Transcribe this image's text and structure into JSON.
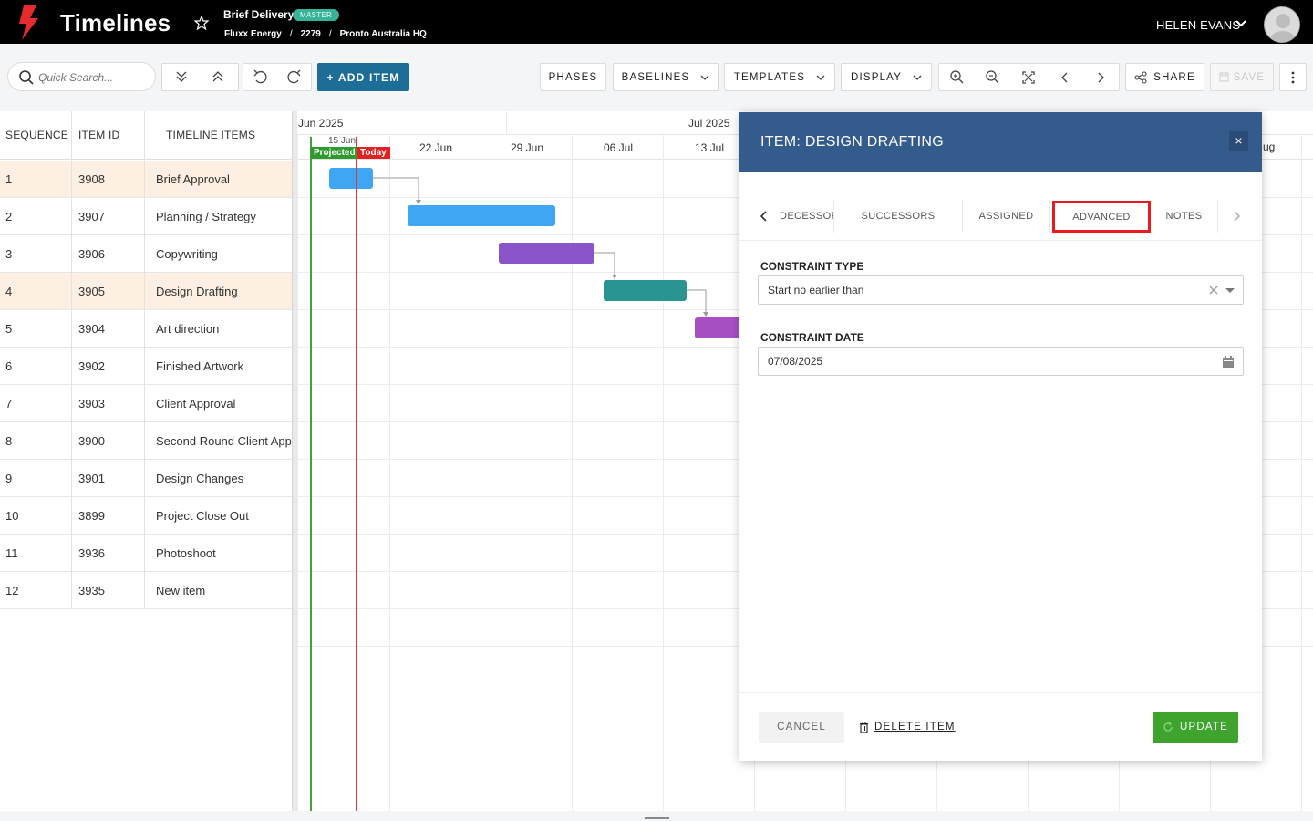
{
  "app": {
    "title": "Timelines"
  },
  "project": {
    "title": "Brief Delivery",
    "badge": "MASTER",
    "breadcrumb": [
      "Fluxx Energy",
      "2279",
      "Pronto Australia HQ"
    ],
    "breadcrumb_sep": "/"
  },
  "user": {
    "name": "HELEN EVANS"
  },
  "toolbar": {
    "search_placeholder": "Quick Search...",
    "add_item": "+ ADD ITEM",
    "phases": "PHASES",
    "baselines": "BASELINES",
    "templates": "TEMPLATES",
    "display": "DISPLAY",
    "share": "SHARE",
    "save": "SAVE"
  },
  "grid": {
    "columns": [
      "SEQUENCE",
      "ITEM ID",
      "TIMELINE ITEMS"
    ],
    "rows": [
      {
        "seq": "1",
        "id": "3908",
        "name": "Brief Approval",
        "highlight": true
      },
      {
        "seq": "2",
        "id": "3907",
        "name": "Planning / Strategy",
        "highlight": false
      },
      {
        "seq": "3",
        "id": "3906",
        "name": "Copywriting",
        "highlight": false
      },
      {
        "seq": "4",
        "id": "3905",
        "name": "Design Drafting",
        "highlight": true
      },
      {
        "seq": "5",
        "id": "3904",
        "name": "Art direction",
        "highlight": false
      },
      {
        "seq": "6",
        "id": "3902",
        "name": "Finished Artwork",
        "highlight": false
      },
      {
        "seq": "7",
        "id": "3903",
        "name": "Client Approval",
        "highlight": false
      },
      {
        "seq": "8",
        "id": "3900",
        "name": "Second Round Client Approval",
        "highlight": false
      },
      {
        "seq": "9",
        "id": "3901",
        "name": "Design Changes",
        "highlight": false
      },
      {
        "seq": "10",
        "id": "3899",
        "name": "Project Close Out",
        "highlight": false
      },
      {
        "seq": "11",
        "id": "3936",
        "name": "Photoshoot",
        "highlight": false
      },
      {
        "seq": "12",
        "id": "3935",
        "name": "New item",
        "highlight": false
      }
    ]
  },
  "gantt": {
    "months": [
      "Jun 2025",
      "Jul 2025"
    ],
    "month_partial": "ug",
    "weeks": [
      "15 Jun",
      "22 Jun",
      "29 Jun",
      "06 Jul",
      "13 Jul"
    ],
    "projected_label": "Projected",
    "today_label": "Today",
    "colors": {
      "blue": "#3fa6f3",
      "purple": "#8a55c9",
      "teal": "#2a9590",
      "magenta": "#a94fc4",
      "today": "#e03b3b",
      "projected": "#3ea33e"
    }
  },
  "modal": {
    "title": "ITEM: DESIGN DRAFTING",
    "close": "×",
    "tabs": [
      "DECESSORS",
      "SUCCESSORS",
      "ASSIGNED",
      "ADVANCED",
      "NOTES"
    ],
    "active_tab": "ADVANCED",
    "constraint_type_label": "CONSTRAINT TYPE",
    "constraint_type_value": "Start no earlier than",
    "constraint_date_label": "CONSTRAINT DATE",
    "constraint_date_value": "07/08/2025",
    "cancel": "CANCEL",
    "delete": "DELETE ITEM",
    "update": "UPDATE"
  }
}
